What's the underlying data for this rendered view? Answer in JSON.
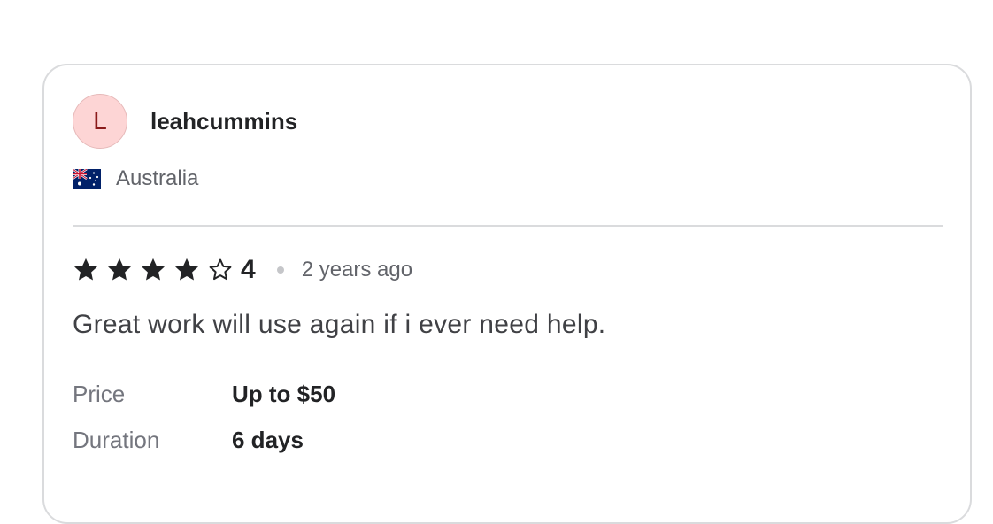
{
  "reviewer": {
    "initial": "L",
    "username": "leahcummins",
    "country": "Australia",
    "avatar_bg": "#fdd5d5",
    "avatar_fg": "#8a1a1a"
  },
  "review": {
    "rating": "4",
    "stars_filled": 4,
    "stars_total": 5,
    "time_ago": "2 years ago",
    "text": "Great work will use again if i ever need help."
  },
  "details": {
    "price_label": "Price",
    "price_value": "Up to $50",
    "duration_label": "Duration",
    "duration_value": "6 days"
  },
  "icons": {
    "flag": "australia-flag-icon",
    "star_filled": "star-filled-icon",
    "star_empty": "star-outline-icon"
  }
}
